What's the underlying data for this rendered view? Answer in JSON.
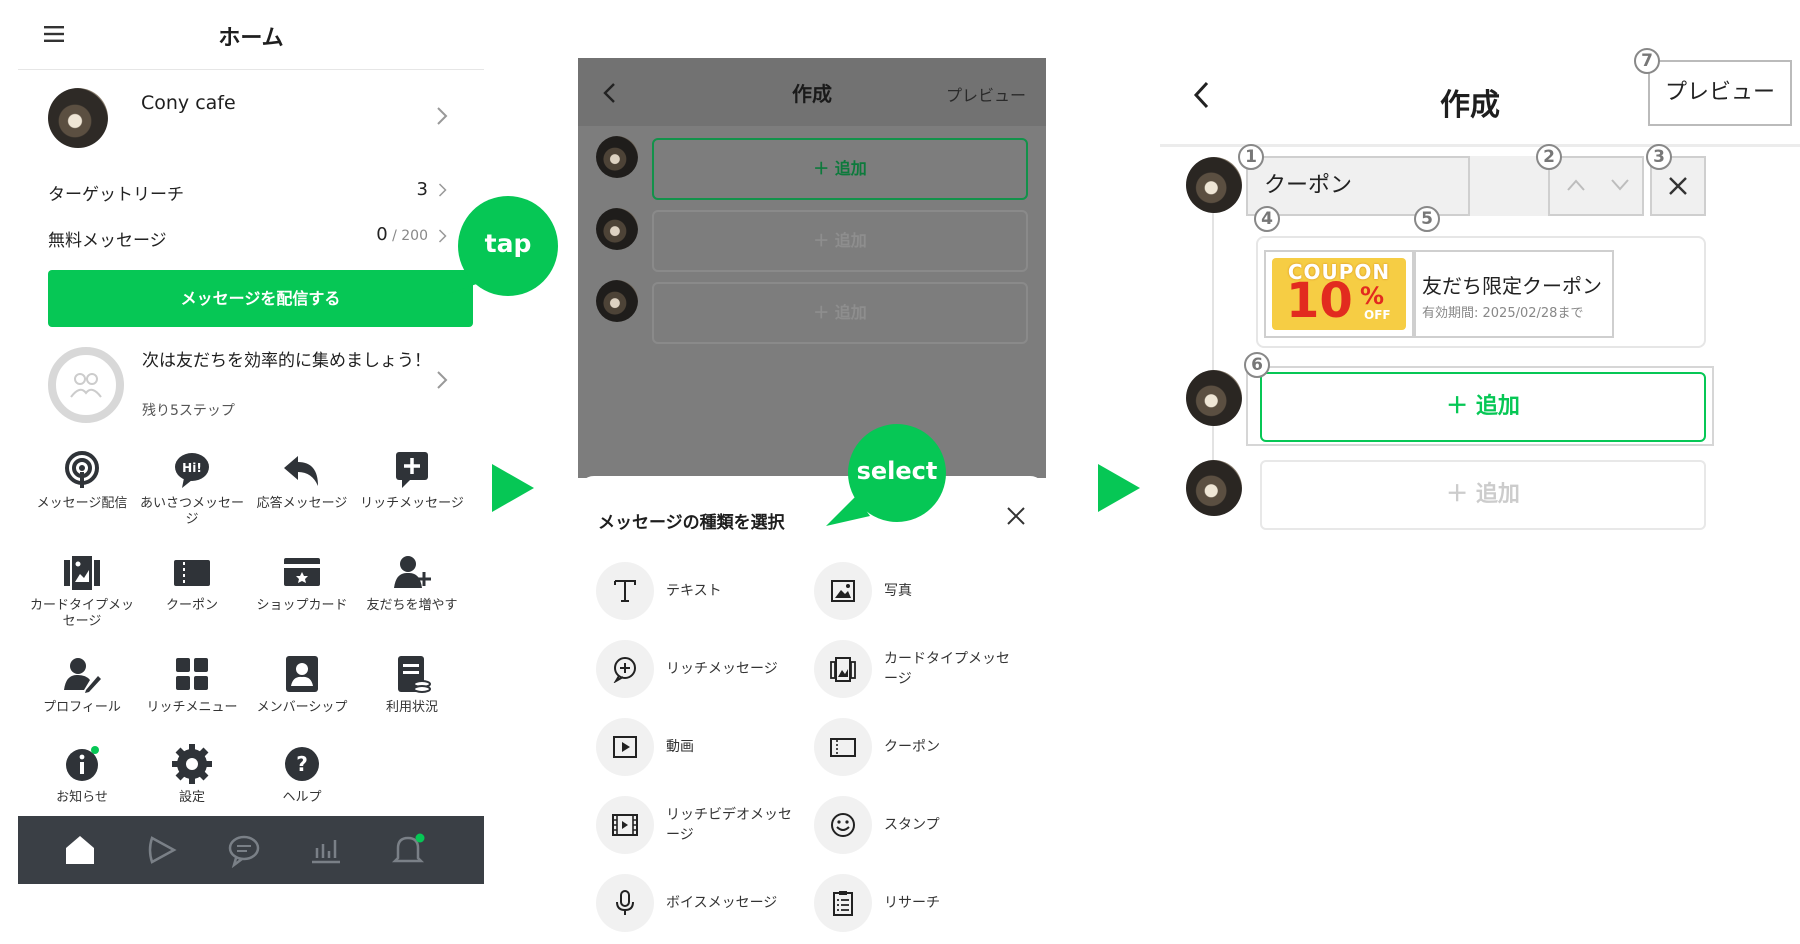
{
  "colors": {
    "accent": "#06c755",
    "tabbar": "#3a3f45"
  },
  "home": {
    "title": "ホーム",
    "account_name": "Cony cafe",
    "target_reach_label": "ターゲットリーチ",
    "target_reach_value": "3",
    "free_msg_label": "無料メッセージ",
    "free_msg_used": "0",
    "free_msg_total": " / 200",
    "send_button": "メッセージを配信する",
    "step_text": "次は友だちを効率的に集めましょう！",
    "step_sub": "残り5ステップ",
    "grid": [
      {
        "label": "メッセージ配信",
        "icon": "broadcast-icon"
      },
      {
        "label": "あいさつメッセージ",
        "icon": "greeting-hi-icon"
      },
      {
        "label": "応答メッセージ",
        "icon": "reply-icon"
      },
      {
        "label": "リッチメッセージ",
        "icon": "rich-message-icon"
      },
      {
        "label": "カードタイプメッセージ",
        "icon": "card-type-icon"
      },
      {
        "label": "クーポン",
        "icon": "coupon-icon"
      },
      {
        "label": "ショップカード",
        "icon": "shop-card-icon"
      },
      {
        "label": "友だちを増やす",
        "icon": "add-friend-icon"
      },
      {
        "label": "プロフィール",
        "icon": "profile-edit-icon"
      },
      {
        "label": "リッチメニュー",
        "icon": "rich-menu-icon"
      },
      {
        "label": "メンバーシップ",
        "icon": "membership-icon"
      },
      {
        "label": "利用状況",
        "icon": "usage-icon"
      },
      {
        "label": "お知らせ",
        "icon": "info-icon"
      },
      {
        "label": "設定",
        "icon": "settings-gear-icon"
      },
      {
        "label": "ヘルプ",
        "icon": "help-icon"
      }
    ],
    "tabs": [
      "home-icon",
      "voom-icon",
      "chat-icon",
      "stats-icon",
      "bell-icon"
    ]
  },
  "tap_bubble": "tap",
  "select_bubble": "select",
  "create_overlay": {
    "title": "作成",
    "preview": "プレビュー",
    "add_label": "＋ 追加",
    "sheet_title": "メッセージの種類を選択",
    "options": [
      {
        "label": "テキスト",
        "icon": "text-icon"
      },
      {
        "label": "写真",
        "icon": "photo-icon"
      },
      {
        "label": "リッチメッセージ",
        "icon": "rich-message-icon"
      },
      {
        "label": "カードタイプメッセージ",
        "icon": "card-type-icon"
      },
      {
        "label": "動画",
        "icon": "video-icon"
      },
      {
        "label": "クーポン",
        "icon": "coupon-icon"
      },
      {
        "label": "リッチビデオメッセージ",
        "icon": "rich-video-icon"
      },
      {
        "label": "スタンプ",
        "icon": "sticker-icon"
      },
      {
        "label": "ボイスメッセージ",
        "icon": "mic-icon"
      },
      {
        "label": "リサーチ",
        "icon": "research-icon"
      }
    ]
  },
  "create_detail": {
    "title": "作成",
    "preview": "プレビュー",
    "field_value": "クーポン",
    "coupon_top": "COUPON",
    "coupon_big": "10",
    "coupon_pct": "%",
    "coupon_off": "OFF",
    "coupon_title": "友だち限定クーポン",
    "coupon_date": "有効期間: 2025/02/28まで",
    "add_label": "追加",
    "badges": [
      "1",
      "2",
      "3",
      "4",
      "5",
      "6",
      "7"
    ]
  }
}
